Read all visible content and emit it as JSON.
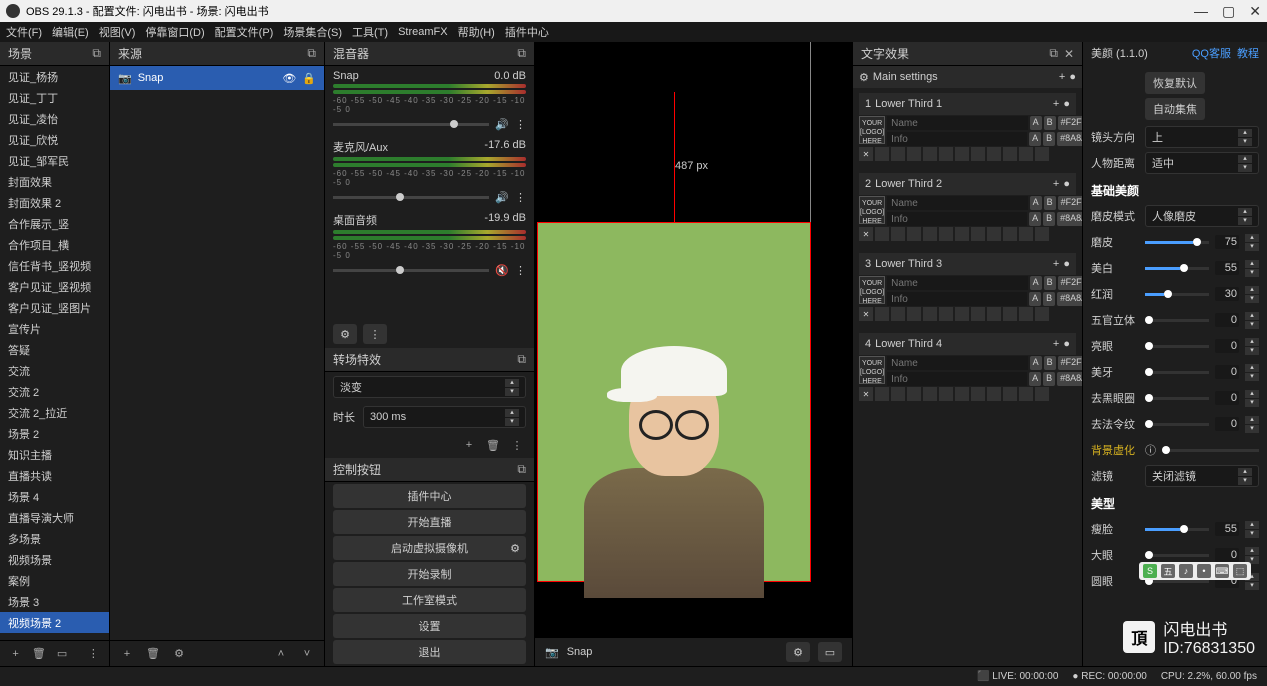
{
  "titlebar": "OBS 29.1.3 - 配置文件: 闪电出书 - 场景: 闪电出书",
  "menu": [
    "文件(F)",
    "编辑(E)",
    "视图(V)",
    "停靠窗口(D)",
    "配置文件(P)",
    "场景集合(S)",
    "工具(T)",
    "StreamFX",
    "帮助(H)",
    "插件中心"
  ],
  "scenesHeader": "场景",
  "scenes": [
    "见证_杨扬",
    "见证_丁丁",
    "见证_凌怡",
    "见证_欣悦",
    "见证_邹军民",
    "封面效果",
    "封面效果 2",
    "合作展示_竖",
    "合作项目_横",
    "信任背书_竖视频",
    "客户见证_竖视频",
    "客户见证_竖图片",
    "宣传片",
    "答疑",
    "交流",
    "交流 2",
    "交流 2_拉近",
    "场景 2",
    "知识主播",
    "直播共读",
    "场景 4",
    "直播导演大师",
    "多场景",
    "视频场景",
    "案例",
    "场景 3",
    "视频场景 2"
  ],
  "activeScene": "视频场景 2",
  "sourcesHeader": "来源",
  "sources": [
    {
      "name": "Snap"
    }
  ],
  "mixerHeader": "混音器",
  "mixer": [
    {
      "name": "Snap",
      "db": "0.0 dB"
    },
    {
      "name": "麦克风/Aux",
      "db": "-17.6 dB"
    },
    {
      "name": "桌面音频",
      "db": "-19.9 dB"
    }
  ],
  "ticks": "-60 -55 -50 -45 -40 -35 -30 -25 -20 -15 -10 -5 0",
  "transHeader": "转场特效",
  "transType": "淡变",
  "durationLabel": "时长",
  "durationValue": "300 ms",
  "controlsHeader": "控制按钮",
  "controls": [
    "插件中心",
    "开始直播",
    "启动虚拟摄像机",
    "开始录制",
    "工作室模式",
    "设置",
    "退出"
  ],
  "previewSource": "Snap",
  "pxLabel": "487 px",
  "textEffectsHeader": "文字效果",
  "teMain": "Main settings",
  "lowerThirds": [
    "Lower Third 1",
    "Lower Third 2",
    "Lower Third 3",
    "Lower Third 4"
  ],
  "logoText": "YOUR [LOGO] HERE",
  "tePlaceholder1": "Name",
  "tePlaceholder2": "Info",
  "teColor1": "#F2F2F",
  "teColor2": "#8A8A8",
  "beautyHeader": "美颜 (1.1.0)",
  "beautyLinks": [
    "QQ客服",
    "教程"
  ],
  "beautyBtns": [
    "恢复默认",
    "自动集焦"
  ],
  "lensDirLabel": "镜头方向",
  "lensDirValue": "上",
  "distLabel": "人物距离",
  "distValue": "适中",
  "basicSection": "基础美颜",
  "skinModeLabel": "磨皮模式",
  "skinModeValue": "人像磨皮",
  "sliders": [
    {
      "label": "磨皮",
      "val": 75
    },
    {
      "label": "美白",
      "val": 55
    },
    {
      "label": "红润",
      "val": 30
    },
    {
      "label": "五官立体",
      "val": 0
    },
    {
      "label": "亮眼",
      "val": 0
    },
    {
      "label": "美牙",
      "val": 0
    },
    {
      "label": "去黑眼圈",
      "val": 0
    },
    {
      "label": "去法令纹",
      "val": 0
    }
  ],
  "bgBlurLabel": "背景虚化",
  "filterLabel": "滤镜",
  "filterValue": "关闭滤镜",
  "shapeSection": "美型",
  "shapeSliders": [
    {
      "label": "瘦脸",
      "val": 55
    },
    {
      "label": "大眼",
      "val": 0
    },
    {
      "label": "圆眼",
      "val": 0
    }
  ],
  "status": {
    "live": "LIVE: 00:00:00",
    "rec": "REC: 00:00:00",
    "cpu": "CPU: 2.2%, 60.00 fps"
  },
  "watermark": {
    "line1": "闪电出书",
    "line2": "ID:76831350"
  }
}
